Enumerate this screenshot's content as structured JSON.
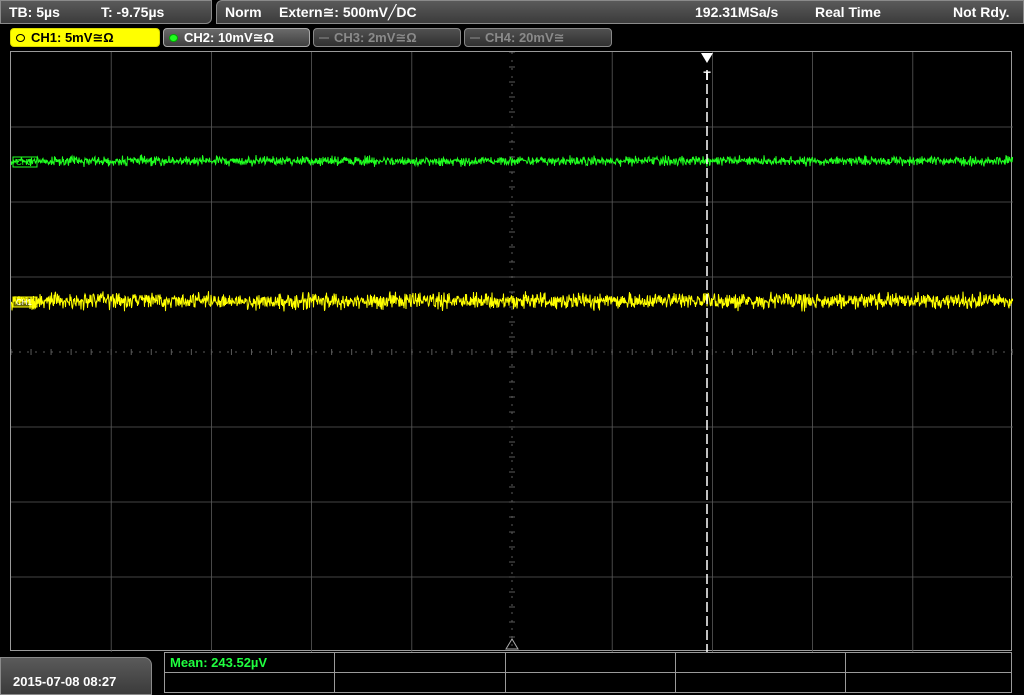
{
  "topbar": {
    "timebase": "TB: 5µs",
    "trigger_time": "T: -9.75µs",
    "mode": "Norm",
    "trigger_source": "Extern≅: 500mV╱DC",
    "sample_rate": "192.31MSa/s",
    "acquisition": "Real Time",
    "status": "Not Rdy."
  },
  "channels": [
    {
      "label": "CH1: 5mV≅Ω",
      "color": "#ffff00",
      "active": true
    },
    {
      "label": "CH2: 10mV≅Ω",
      "color": "#20ff20",
      "active": true
    },
    {
      "label": "CH3: 2mV≅Ω",
      "color": "#666666",
      "active": false
    },
    {
      "label": "CH4: 20mV≅",
      "color": "#666666",
      "active": false
    }
  ],
  "traces": {
    "ch1_marker": "CH1",
    "ch2_marker": "CH2",
    "trigger_marker": "T"
  },
  "measurement": {
    "mean": "Mean: 243.52µV"
  },
  "footer": {
    "datetime": "2015-07-08 08:27"
  },
  "colors": {
    "ch1": "#ffff00",
    "ch2": "#20ff20",
    "grid": "#5a5a5a",
    "background": "#000000"
  }
}
